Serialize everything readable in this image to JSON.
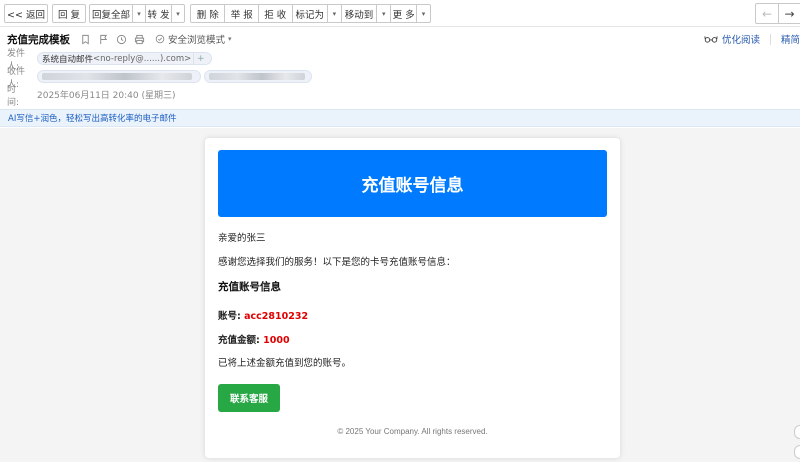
{
  "toolbar": {
    "back": "<< 返回",
    "reply": "回 复",
    "reply_all": "回复全部",
    "forward": "转 发",
    "delete": "删 除",
    "report": "举 报",
    "reject": "拒 收",
    "mark_as": "标记为",
    "move_to": "移动到",
    "more": "更 多",
    "prev_arrow": "←",
    "next_arrow": "→"
  },
  "header": {
    "subject": "充值完成模板",
    "safe_mode": "安全浏览模式",
    "optimize_read": "优化阅读",
    "simplified": "精简",
    "from_label": "发件人:",
    "from_name": "系统自动邮件",
    "from_email": "<no-reply@......).com>",
    "to_label": "收件人:",
    "time_label": "时　间:",
    "time_value": "2025年06月11日 20:40 (星期三)"
  },
  "ai_bar": {
    "text": "AI写信+润色，轻松写出高转化率的电子邮件"
  },
  "mail": {
    "banner_title": "充值账号信息",
    "greeting": "亲爱的张三",
    "intro": "感谢您选择我们的服务！以下是您的卡号充值账号信息：",
    "section_title": "充值账号信息",
    "account_label": "账号: ",
    "account_value": "acc2810232",
    "amount_label": "充值金额: ",
    "amount_value": "1000",
    "note": "已将上述金额充值到您的账号。",
    "cta": "联系客服",
    "footer": "© 2025 Your Company. All rights reserved."
  },
  "colors": {
    "banner": "#007bff",
    "cta": "#28a745",
    "highlight": "#e00000",
    "link": "#2a5db0"
  }
}
